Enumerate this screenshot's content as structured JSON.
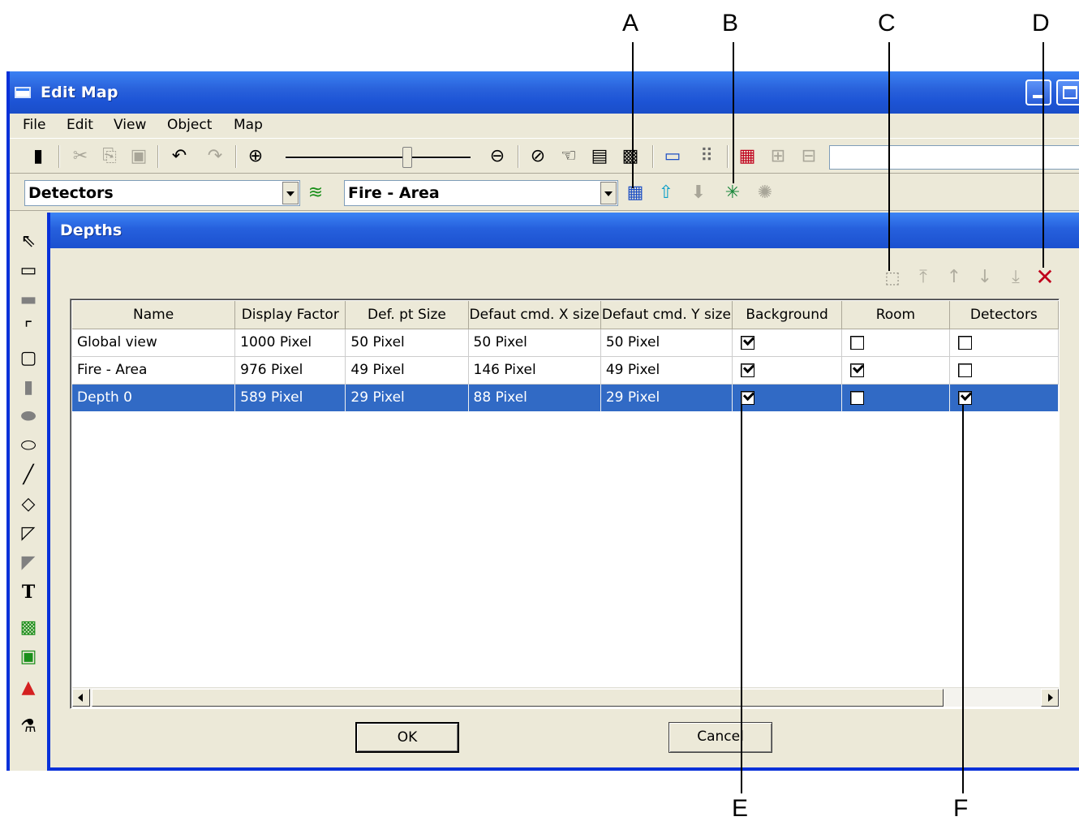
{
  "callouts": {
    "a": "A",
    "b": "B",
    "c": "C",
    "d": "D",
    "e": "E",
    "f": "F"
  },
  "window": {
    "title": "Edit Map"
  },
  "menu": {
    "items": [
      "File",
      "Edit",
      "View",
      "Object",
      "Map"
    ]
  },
  "toolbar2": {
    "layer_combo_value": "Detectors",
    "depth_combo_value": "Fire - Area"
  },
  "dialog": {
    "title": "Depths",
    "columns": [
      "Name",
      "Display Factor",
      "Def. pt Size",
      "Defaut cmd. X size",
      "Defaut cmd. Y size",
      "Background",
      "Room",
      "Detectors"
    ],
    "rows": [
      {
        "name": "Global view",
        "display_factor": "1000 Pixel",
        "pt_size": "50 Pixel",
        "x_size": "50 Pixel",
        "y_size": "50 Pixel",
        "background": true,
        "room": false,
        "detectors": false
      },
      {
        "name": "Fire - Area",
        "display_factor": "976 Pixel",
        "pt_size": "49 Pixel",
        "x_size": "146 Pixel",
        "y_size": "49 Pixel",
        "background": true,
        "room": true,
        "detectors": false
      },
      {
        "name": "Depth 0",
        "display_factor": "589 Pixel",
        "pt_size": "29 Pixel",
        "x_size": "88 Pixel",
        "y_size": "29 Pixel",
        "background": true,
        "room": false,
        "detectors": true
      }
    ],
    "selected_row": "Depth 0",
    "ok_label": "OK",
    "cancel_label": "Cancel"
  },
  "colors": {
    "titlebar": "#2a63dc",
    "selection": "#316ac5",
    "delete": "#c0001b",
    "face": "#ece9d8"
  }
}
